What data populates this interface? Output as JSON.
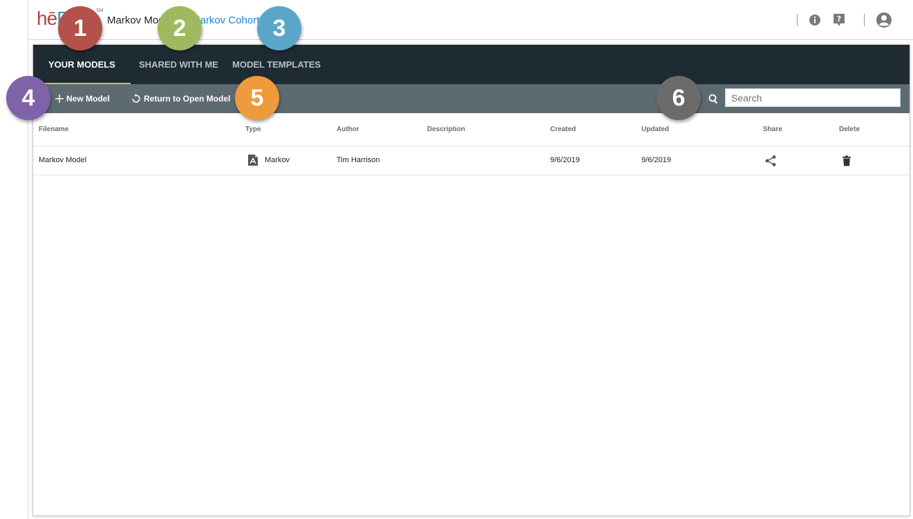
{
  "app": {
    "logo_h": "hē",
    "logo_ep": "P",
    "logo_mark": "SM",
    "model_name": "Markov Model",
    "model_type": "Markov Cohort"
  },
  "tabs": [
    {
      "label": "YOUR MODELS",
      "active": true
    },
    {
      "label": "SHARED WITH ME",
      "active": false
    },
    {
      "label": "MODEL TEMPLATES",
      "active": false
    }
  ],
  "toolbar": {
    "new_model_label": "New Model",
    "return_label": "Return to Open Model",
    "search_placeholder": "Search"
  },
  "table": {
    "columns": [
      "Filename",
      "Type",
      "Author",
      "Description",
      "Created",
      "Updated",
      "Share",
      "Delete"
    ],
    "rows": [
      {
        "filename": "Markov Model",
        "type": "Markov",
        "author": "Tim Harrison",
        "description": "",
        "created": "9/6/2019",
        "updated": "9/6/2019"
      }
    ]
  },
  "badges": [
    {
      "number": "1",
      "color": "#b4514b"
    },
    {
      "number": "2",
      "color": "#9fba5e"
    },
    {
      "number": "3",
      "color": "#5aa6c8"
    },
    {
      "number": "4",
      "color": "#7f62a8"
    },
    {
      "number": "5",
      "color": "#ef9a3c"
    },
    {
      "number": "6",
      "color": "#6b6b6b"
    }
  ],
  "icons": {
    "info": "info-icon",
    "help": "help-icon",
    "account": "account-icon",
    "new_model": "plus-icon",
    "return": "refresh-icon",
    "search": "search-icon",
    "type": "markov-type-icon",
    "share": "share-icon",
    "delete": "trash-icon"
  },
  "colors": {
    "nav_bg": "#1f2b33",
    "toolbar_bg": "#5e6a72",
    "active_tab_underline": "#b6c96a",
    "link_blue": "#1e88d6"
  }
}
